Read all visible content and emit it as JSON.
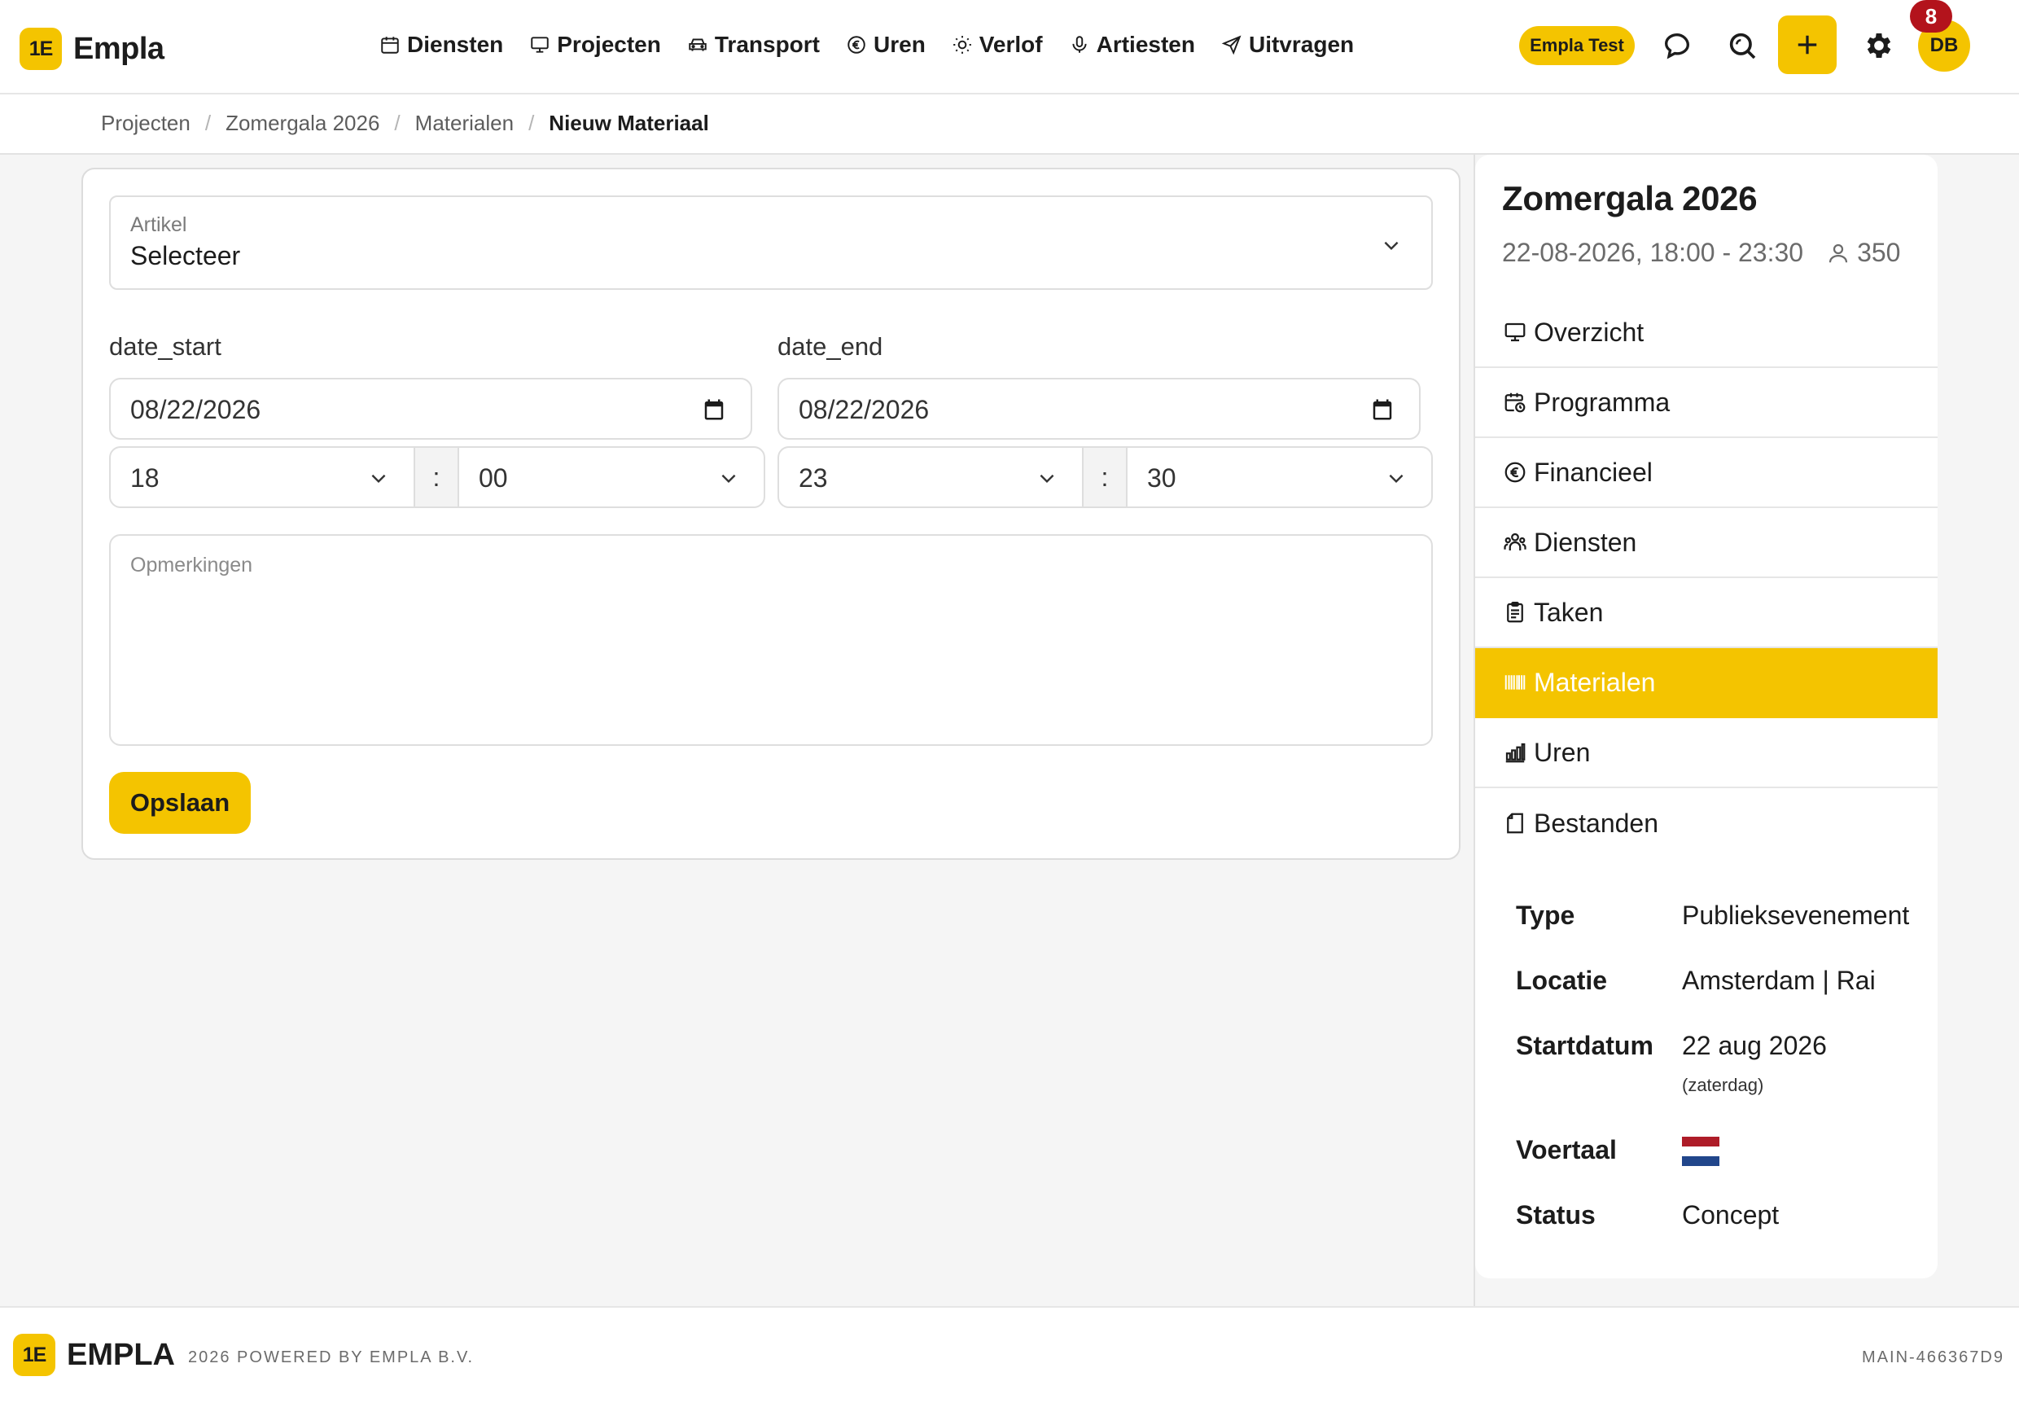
{
  "app": {
    "logo_mark": "1E",
    "name": "Empla"
  },
  "nav": {
    "items": [
      {
        "label": "Diensten",
        "icon": "calendar-icon"
      },
      {
        "label": "Projecten",
        "icon": "monitor-icon"
      },
      {
        "label": "Transport",
        "icon": "car-icon"
      },
      {
        "label": "Uren",
        "icon": "euro-icon"
      },
      {
        "label": "Verlof",
        "icon": "sun-icon"
      },
      {
        "label": "Artiesten",
        "icon": "microphone-icon"
      },
      {
        "label": "Uitvragen",
        "icon": "send-icon"
      }
    ]
  },
  "header": {
    "company": "Empla Test",
    "notifications_count": "8",
    "user_initials": "DB",
    "icons": [
      "chat-icon",
      "search-icon",
      "plus-icon",
      "gear-icon"
    ]
  },
  "breadcrumb": {
    "items": [
      "Projecten",
      "Zomergala 2026",
      "Materialen"
    ],
    "current": "Nieuw Materiaal",
    "separator": "/"
  },
  "form": {
    "article": {
      "label": "Artikel",
      "value": "Selecteer"
    },
    "date_start": {
      "label": "date_start",
      "date": "08/22/2026",
      "hour": "18",
      "minute": "00"
    },
    "date_end": {
      "label": "date_end",
      "date": "08/22/2026",
      "hour": "23",
      "minute": "30"
    },
    "time_separator": ":",
    "remarks": {
      "placeholder": "Opmerkingen"
    },
    "save_label": "Opslaan"
  },
  "project": {
    "title": "Zomergala 2026",
    "datetime": "22-08-2026, 18:00 - 23:30",
    "guests": "350",
    "menu": [
      {
        "label": "Overzicht",
        "icon": "monitor-icon",
        "active": false
      },
      {
        "label": "Programma",
        "icon": "calendar-clock-icon",
        "active": false
      },
      {
        "label": "Financieel",
        "icon": "euro-icon",
        "active": false
      },
      {
        "label": "Diensten",
        "icon": "people-icon",
        "active": false
      },
      {
        "label": "Taken",
        "icon": "clipboard-icon",
        "active": false
      },
      {
        "label": "Materialen",
        "icon": "barcode-icon",
        "active": true
      },
      {
        "label": "Uren",
        "icon": "bar-chart-icon",
        "active": false
      },
      {
        "label": "Bestanden",
        "icon": "file-icon",
        "active": false
      }
    ],
    "info": {
      "type": {
        "key": "Type",
        "value": "Publieksevenement"
      },
      "location": {
        "key": "Locatie",
        "value": "Amsterdam | Rai"
      },
      "start": {
        "key": "Startdatum",
        "value": "22 aug 2026",
        "sub": "(zaterdag)"
      },
      "language": {
        "key": "Voertaal",
        "flag": "netherlands-flag"
      },
      "status": {
        "key": "Status",
        "value": "Concept"
      }
    }
  },
  "footer": {
    "brand": "EMPLA",
    "powered": "2026 POWERED BY EMPLA B.V.",
    "version": "MAIN-466367D9"
  },
  "colors": {
    "accent": "#f4c400",
    "badge": "#b3131c",
    "background": "#f5f5f5",
    "text": "#1c1c1c"
  }
}
